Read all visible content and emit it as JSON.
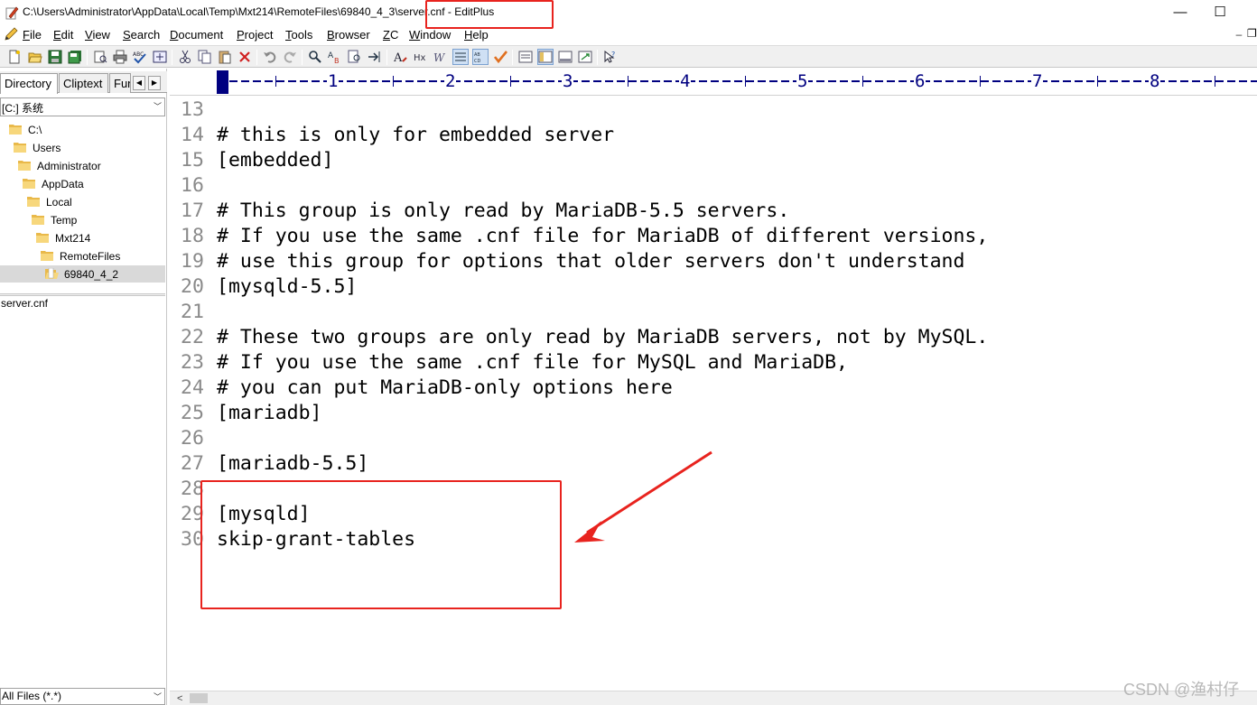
{
  "window": {
    "title": "C:\\Users\\Administrator\\AppData\\Local\\Temp\\Mxt214\\RemoteFiles\\69840_4_3\\server.cnf - EditPlus",
    "minimize_glyph": "—",
    "maximize_glyph": "☐"
  },
  "menu": {
    "items": [
      {
        "label": "File",
        "u": "F",
        "rest": "ile"
      },
      {
        "label": "Edit",
        "u": "E",
        "rest": "dit"
      },
      {
        "label": "View",
        "u": "V",
        "rest": "iew"
      },
      {
        "label": "Search",
        "u": "S",
        "rest": "earch"
      },
      {
        "label": "Document",
        "u": "D",
        "rest": "ocument"
      },
      {
        "label": "Project",
        "u": "P",
        "rest": "roject"
      },
      {
        "label": "Tools",
        "u": "T",
        "rest": "ools"
      },
      {
        "label": "Browser",
        "u": "B",
        "rest": "rowser"
      },
      {
        "label": "ZC",
        "u": "Z",
        "rest": "C"
      },
      {
        "label": "Window",
        "u": "W",
        "rest": "indow"
      },
      {
        "label": "Help",
        "u": "H",
        "rest": "elp"
      }
    ]
  },
  "left_panel": {
    "tabs": [
      "Directory",
      "Cliptext",
      "Fun"
    ],
    "active_tab": "Directory",
    "drive": "[C:] 系统",
    "tree": [
      {
        "label": "C:\\",
        "depth": 0
      },
      {
        "label": "Users",
        "depth": 1
      },
      {
        "label": "Administrator",
        "depth": 2
      },
      {
        "label": "AppData",
        "depth": 3
      },
      {
        "label": "Local",
        "depth": 4
      },
      {
        "label": "Temp",
        "depth": 5
      },
      {
        "label": "Mxt214",
        "depth": 6
      },
      {
        "label": "RemoteFiles",
        "depth": 7
      },
      {
        "label": "69840_4_2",
        "depth": 8,
        "selected": true
      }
    ],
    "files": [
      "server.cnf"
    ],
    "filter": "All Files (*.*)"
  },
  "ruler": {
    "numbers": [
      "1",
      "2",
      "3",
      "4",
      "5",
      "6",
      "7",
      "8"
    ]
  },
  "editor": {
    "lines": [
      {
        "num": "13",
        "text": ""
      },
      {
        "num": "14",
        "text": "# this is only for embedded server"
      },
      {
        "num": "15",
        "text": "[embedded]"
      },
      {
        "num": "16",
        "text": ""
      },
      {
        "num": "17",
        "text": "# This group is only read by MariaDB-5.5 servers."
      },
      {
        "num": "18",
        "text": "# If you use the same .cnf file for MariaDB of different versions,"
      },
      {
        "num": "19",
        "text": "# use this group for options that older servers don't understand"
      },
      {
        "num": "20",
        "text": "[mysqld-5.5]"
      },
      {
        "num": "21",
        "text": ""
      },
      {
        "num": "22",
        "text": "# These two groups are only read by MariaDB servers, not by MySQL."
      },
      {
        "num": "23",
        "text": "# If you use the same .cnf file for MySQL and MariaDB,"
      },
      {
        "num": "24",
        "text": "# you can put MariaDB-only options here"
      },
      {
        "num": "25",
        "text": "[mariadb]"
      },
      {
        "num": "26",
        "text": ""
      },
      {
        "num": "27",
        "text": "[mariadb-5.5]"
      },
      {
        "num": "28",
        "text": ""
      },
      {
        "num": "29",
        "text": "[mysqld]"
      },
      {
        "num": "30",
        "text": "skip-grant-tables"
      }
    ]
  },
  "watermark": "CSDN @渔村仔",
  "colors": {
    "ruler": "#000080",
    "annotation": "#e8231e",
    "line_number": "#8a8a8a"
  }
}
